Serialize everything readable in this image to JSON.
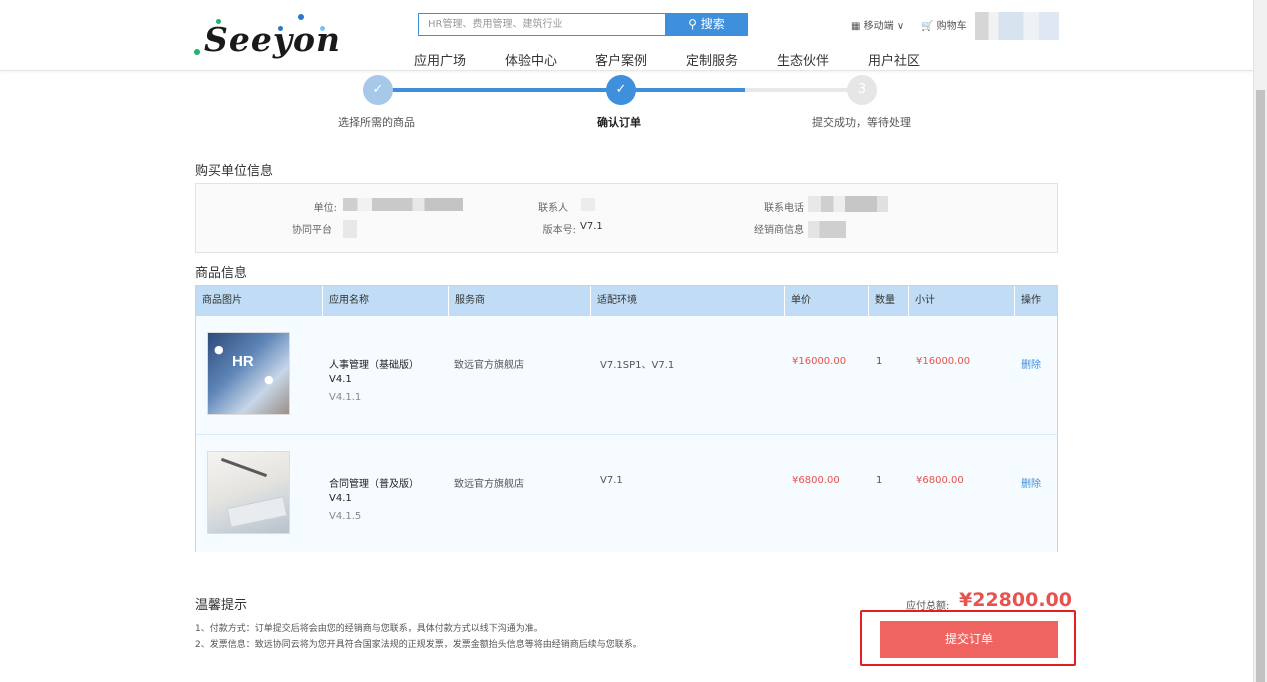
{
  "header": {
    "logo_text": "Seeyon",
    "search_placeholder": "HR管理、费用管理、建筑行业",
    "search_button": "搜索",
    "nav": [
      "应用广场",
      "体验中心",
      "客户案例",
      "定制服务",
      "生态伙伴",
      "用户社区"
    ],
    "mobile": "移动端",
    "cart": "购物车"
  },
  "steps": [
    {
      "label": "选择所需的商品",
      "state": "done"
    },
    {
      "label": "确认订单",
      "state": "current"
    },
    {
      "label": "提交成功，等待处理",
      "state": "pending",
      "number": "3"
    }
  ],
  "buyer": {
    "title": "购买单位信息",
    "unit_label": "单位:",
    "contact_label": "联系人",
    "phone_label": "联系电话",
    "platform_label": "协同平台",
    "version_label": "版本号:",
    "version_value": "V7.1",
    "dealer_label": "经销商信息"
  },
  "products": {
    "title": "商品信息",
    "columns": [
      "商品图片",
      "应用名称",
      "服务商",
      "适配环境",
      "单价",
      "数量",
      "小计",
      "操作"
    ],
    "rows": [
      {
        "name": "人事管理（基础版）",
        "version": "V4.1",
        "sub_version": "V4.1.1",
        "vendor": "致远官方旗舰店",
        "env": "V7.1SP1、V7.1",
        "price": "¥16000.00",
        "qty": "1",
        "subtotal": "¥16000.00",
        "action": "删除",
        "thumb_text": "HR"
      },
      {
        "name": "合同管理（普及版）",
        "version": "V4.1",
        "sub_version": "V4.1.5",
        "vendor": "致远官方旗舰店",
        "env": "V7.1",
        "price": "¥6800.00",
        "qty": "1",
        "subtotal": "¥6800.00",
        "action": "删除",
        "thumb_text": ""
      }
    ]
  },
  "tips": {
    "title": "温馨提示",
    "lines": [
      "1、付款方式：订单提交后将会由您的经销商与您联系，具体付款方式以线下沟通为准。",
      "2、发票信息：致远协同云将为您开具符合国家法规的正规发票，发票金额抬头信息等将由经销商后续与您联系。"
    ]
  },
  "summary": {
    "total_label": "应付总额:",
    "total_value": "¥22800.00",
    "submit_label": "提交订单"
  },
  "colors": {
    "accent": "#3e8fdc",
    "price": "#e8534f",
    "submit": "#ef6461",
    "highlight_border": "#e21f1f"
  }
}
